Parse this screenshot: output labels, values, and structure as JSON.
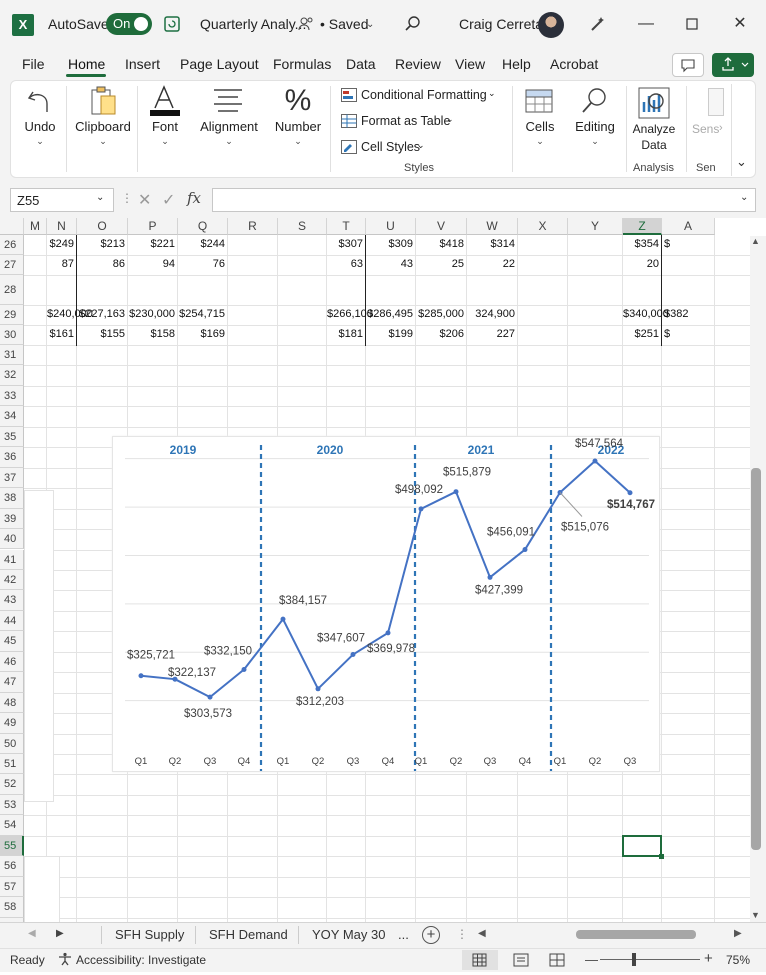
{
  "titlebar": {
    "app_icon": "X",
    "autosave_label": "AutoSave",
    "autosave_state": "On",
    "doc_title": "Quarterly Analy...",
    "saved_status": "• Saved",
    "user_name": "Craig Cerreta"
  },
  "menu": {
    "tabs": [
      "File",
      "Home",
      "Insert",
      "Page Layout",
      "Formulas",
      "Data",
      "Review",
      "View",
      "Help",
      "Acrobat"
    ],
    "active": "Home"
  },
  "ribbon": {
    "undo": "Undo",
    "clipboard": "Clipboard",
    "font": "Font",
    "alignment": "Alignment",
    "number": "Number",
    "conditional_formatting": "Conditional Formatting",
    "format_as_table": "Format as Table",
    "cell_styles": "Cell Styles",
    "styles_group": "Styles",
    "cells": "Cells",
    "editing": "Editing",
    "analyze_data_1": "Analyze",
    "analyze_data_2": "Data",
    "analysis_group": "Analysis",
    "sensitivity": "Sens",
    "sen_group": "Sen"
  },
  "formula_bar": {
    "name_box": "Z55",
    "fx": "fx",
    "formula": ""
  },
  "grid": {
    "columns": [
      "M",
      "N",
      "O",
      "P",
      "Q",
      "R",
      "S",
      "T",
      "U",
      "V",
      "W",
      "X",
      "Y",
      "Z",
      "A"
    ],
    "rows": [
      "26",
      "27",
      "28",
      "29",
      "30",
      "31",
      "32",
      "33",
      "34",
      "35",
      "36",
      "37",
      "38",
      "39",
      "40",
      "41",
      "42",
      "43",
      "44",
      "45",
      "46",
      "47",
      "48",
      "49",
      "50",
      "51",
      "52",
      "53",
      "54",
      "55",
      "56",
      "57",
      "58",
      "59"
    ],
    "row26": [
      "$249",
      "$213",
      "$221",
      "$244",
      "$307",
      "$309",
      "$418",
      "$314",
      "$354",
      "$"
    ],
    "row27": [
      "87",
      "86",
      "94",
      "76",
      "63",
      "43",
      "25",
      "22",
      "20"
    ],
    "row29": [
      "$240,000",
      "$227,163",
      "$230,000",
      "$254,715",
      "$266,100",
      "$286,495",
      "$285,000",
      "324,900",
      "$340,000",
      "$382"
    ],
    "row30": [
      "$161",
      "$155",
      "$158",
      "$169",
      "$181",
      "$199",
      "$206",
      "227",
      "$251",
      "$"
    ]
  },
  "chart_data": {
    "type": "line",
    "years": [
      "2019",
      "2020",
      "2021",
      "2022"
    ],
    "x": [
      "Q1",
      "Q2",
      "Q3",
      "Q4",
      "Q1",
      "Q2",
      "Q3",
      "Q4",
      "Q1",
      "Q2",
      "Q3",
      "Q4",
      "Q1",
      "Q2",
      "Q3"
    ],
    "values": [
      325721,
      322137,
      303573,
      332150,
      384157,
      312203,
      347607,
      369978,
      498092,
      515879,
      427399,
      456091,
      515076,
      547564,
      514767
    ],
    "labels": [
      "$325,721",
      "$322,137",
      "$303,573",
      "$332,150",
      "$384,157",
      "$312,203",
      "$347,607",
      "$369,978",
      "$498,092",
      "$515,879",
      "$427,399",
      "$456,091",
      "$515,076",
      "$547,564",
      "$514,767"
    ],
    "ylim": [
      250000,
      560000
    ],
    "grid": true,
    "line_color": "#4472c4",
    "year_color": "#2e75b6"
  },
  "sheet_tabs": {
    "tabs": [
      "SFH Supply",
      "SFH Demand",
      "YOY May 30"
    ],
    "more": "..."
  },
  "status": {
    "ready": "Ready",
    "accessibility": "Accessibility: Investigate",
    "zoom": "75%"
  }
}
